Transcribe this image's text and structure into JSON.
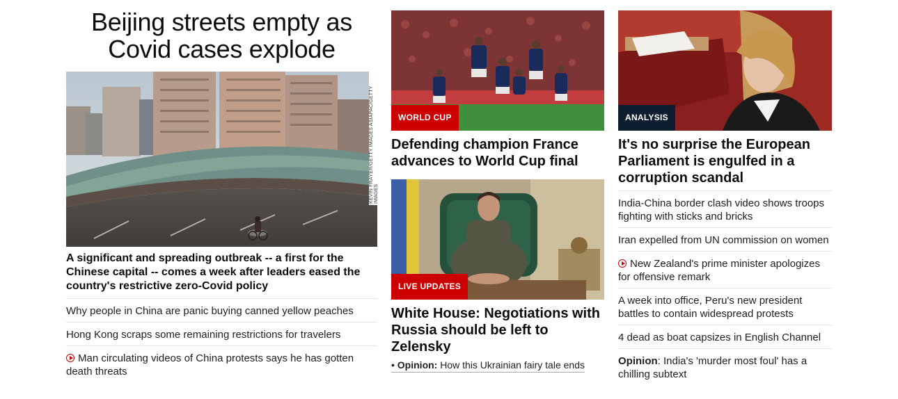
{
  "left": {
    "headline": "Beijing streets empty as Covid cases explode",
    "image_credit": "KEVIN FRAYER/GETTY IMAGES ASIAPAC/GETTY IMAGES",
    "summary": "A significant and spreading outbreak -- a first for the Chinese capital -- comes a week after leaders eased the country's restrictive zero-Covid policy",
    "related": [
      {
        "text": "Why people in China are panic buying canned yellow peaches",
        "video": false
      },
      {
        "text": "Hong Kong scraps some remaining restrictions for travelers",
        "video": false
      },
      {
        "text": "Man circulating videos of China protests says he has gotten death threats",
        "video": true
      }
    ]
  },
  "middle": {
    "story1": {
      "label": "WORLD CUP",
      "title": "Defending champion France advances to World Cup final"
    },
    "story2": {
      "label": "LIVE UPDATES",
      "title": "White House: Negotiations with Russia should be left to Zelensky"
    },
    "opinion": {
      "bullet": "•",
      "prefix": "Opinion:",
      "text": "How this Ukrainian fairy tale ends"
    }
  },
  "right": {
    "story": {
      "label": "ANALYSIS",
      "title": "It's no surprise the European Parliament is engulfed in a corruption scandal"
    },
    "related": [
      {
        "text": "India-China border clash video shows troops fighting with sticks and bricks",
        "video": false
      },
      {
        "text": "Iran expelled from UN commission on women",
        "video": false
      },
      {
        "text": "New Zealand's prime minister apologizes for offensive remark",
        "video": true
      },
      {
        "text": "A week into office, Peru's new president battles to contain widespread protests",
        "video": false
      },
      {
        "text": "4 dead as boat capsizes in English Channel",
        "video": false
      }
    ],
    "opinion": {
      "prefix": "Opinion",
      "text": ": India's 'murder most foul' has a chilling subtext"
    }
  },
  "colors": {
    "accent_red": "#cc0000",
    "analysis_label": "#0c1e30"
  }
}
